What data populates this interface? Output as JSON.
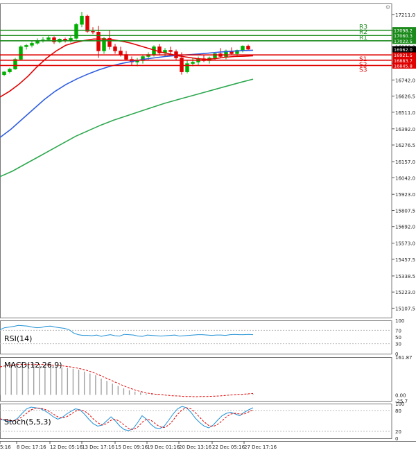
{
  "chart_data": {
    "type": "candlestick",
    "price_panel": {
      "ylim": [
        15040,
        17290
      ],
      "y_ticks": [
        "17211.0",
        "17095.5",
        "16980.0",
        "16862.0",
        "16742.0",
        "16626.5",
        "16511.0",
        "16392.0",
        "16276.5",
        "16157.0",
        "16042.0",
        "15923.0",
        "15807.5",
        "15692.0",
        "15573.0",
        "15457.5",
        "15338.5",
        "15223.0",
        "15107.5"
      ],
      "current_price": {
        "label": "16962.0",
        "value": 16962.0
      },
      "levels": [
        {
          "name": "R3",
          "value": 17098.2,
          "label": "17098.2",
          "color": "#1a8a1a"
        },
        {
          "name": "R2",
          "value": 17060.3,
          "label": "17060.3",
          "color": "#1a8a1a"
        },
        {
          "name": "R1",
          "value": 17022.5,
          "label": "17022.5",
          "color": "#1a8a1a"
        },
        {
          "name": "S1",
          "value": 16921.5,
          "label": "16921.5",
          "color": "#e00000"
        },
        {
          "name": "S2",
          "value": 16883.7,
          "label": "16883.7",
          "color": "#e00000"
        },
        {
          "name": "S3",
          "value": 16845.8,
          "label": "16845.8",
          "color": "#e00000"
        }
      ],
      "candles": [
        [
          16780,
          16805,
          16770,
          16800
        ],
        [
          16800,
          16830,
          16790,
          16820
        ],
        [
          16820,
          16900,
          16815,
          16890
        ],
        [
          16890,
          16990,
          16880,
          16980
        ],
        [
          16980,
          17000,
          16960,
          16990
        ],
        [
          16990,
          17020,
          16975,
          17005
        ],
        [
          17005,
          17040,
          16995,
          17025
        ],
        [
          17025,
          17050,
          17010,
          17030
        ],
        [
          17030,
          17060,
          17020,
          17045
        ],
        [
          17045,
          17055,
          17000,
          17015
        ],
        [
          17015,
          17040,
          17005,
          17035
        ],
        [
          17035,
          17045,
          17010,
          17025
        ],
        [
          17025,
          17060,
          17010,
          17040
        ],
        [
          17040,
          17150,
          17030,
          17140
        ],
        [
          17140,
          17230,
          17120,
          17200
        ],
        [
          17200,
          17210,
          17080,
          17090
        ],
        [
          17090,
          17120,
          17070,
          17085
        ],
        [
          17085,
          17130,
          16900,
          16950
        ],
        [
          16950,
          17050,
          16930,
          17040
        ],
        [
          17040,
          17100,
          16960,
          16980
        ],
        [
          16980,
          17000,
          16930,
          16950
        ],
        [
          16950,
          16980,
          16910,
          16925
        ],
        [
          16925,
          16950,
          16880,
          16890
        ],
        [
          16890,
          16910,
          16850,
          16870
        ],
        [
          16870,
          16900,
          16840,
          16880
        ],
        [
          16880,
          16920,
          16860,
          16910
        ],
        [
          16910,
          16940,
          16880,
          16925
        ],
        [
          16925,
          16990,
          16910,
          16980
        ],
        [
          16980,
          17000,
          16920,
          16935
        ],
        [
          16935,
          16970,
          16910,
          16955
        ],
        [
          16955,
          16980,
          16930,
          16945
        ],
        [
          16945,
          16960,
          16880,
          16900
        ],
        [
          16900,
          16940,
          16780,
          16800
        ],
        [
          16800,
          16880,
          16790,
          16860
        ],
        [
          16860,
          16900,
          16840,
          16870
        ],
        [
          16870,
          16910,
          16850,
          16895
        ],
        [
          16895,
          16920,
          16870,
          16880
        ],
        [
          16880,
          16910,
          16860,
          16900
        ],
        [
          16900,
          16940,
          16880,
          16930
        ],
        [
          16930,
          16970,
          16900,
          16910
        ],
        [
          16910,
          16960,
          16890,
          16950
        ],
        [
          16950,
          16975,
          16920,
          16930
        ],
        [
          16930,
          16960,
          16910,
          16955
        ],
        [
          16955,
          16990,
          16940,
          16985
        ],
        [
          16985,
          16995,
          16955,
          16962
        ]
      ],
      "ma_fast": [
        16620,
        16660,
        16710,
        16770,
        16840,
        16900,
        16950,
        16990,
        17010,
        17025,
        17035,
        17035,
        17030,
        17020,
        17005,
        16985,
        16965,
        16945,
        16930,
        16915,
        16905,
        16895,
        16890,
        16895,
        16905,
        16910,
        16912,
        16915
      ],
      "ma_mid": [
        16330,
        16390,
        16460,
        16530,
        16600,
        16660,
        16710,
        16750,
        16785,
        16815,
        16840,
        16860,
        16875,
        16890,
        16900,
        16910,
        16917,
        16922,
        16928,
        16935,
        16942,
        16948,
        16952,
        16955
      ],
      "ma_slow": [
        16050,
        16090,
        16140,
        16190,
        16240,
        16290,
        16340,
        16380,
        16420,
        16455,
        16485,
        16515,
        16545,
        16575,
        16600,
        16625,
        16650,
        16675,
        16700,
        16725,
        16748
      ]
    },
    "rsi": {
      "label": "RSI(14)",
      "ylim": [
        0,
        100
      ],
      "y_ticks": [
        "100",
        "70",
        "50",
        "30",
        "0"
      ],
      "values": [
        72,
        78,
        80,
        82,
        85,
        84,
        83,
        80,
        78,
        79,
        82,
        83,
        80,
        78,
        76,
        72,
        62,
        57,
        55,
        55,
        54,
        56,
        52,
        55,
        57,
        54,
        53,
        58,
        57,
        56,
        53,
        52,
        56,
        55,
        54,
        53,
        54,
        55,
        56,
        53,
        54,
        55,
        56,
        57,
        57,
        56,
        55,
        56,
        56,
        55,
        57,
        58,
        57,
        57,
        58,
        57
      ]
    },
    "macd": {
      "label": "MACD(12,26,9)",
      "ylim": [
        -25.7,
        161.87
      ],
      "y_ticks": [
        "161.87",
        "0.00",
        "-25.7"
      ],
      "histogram": [
        120,
        128,
        134,
        138,
        136,
        134,
        135,
        132,
        128,
        124,
        122,
        118,
        116,
        112,
        108,
        100,
        92,
        84,
        70,
        60,
        48,
        38,
        28,
        20,
        14,
        10,
        6,
        4,
        3,
        2,
        1,
        1,
        0,
        -1,
        -1,
        0,
        0,
        -1,
        -1,
        0,
        1,
        1,
        2,
        2,
        3,
        3
      ],
      "signal": [
        120,
        125,
        128,
        130,
        131,
        130,
        130,
        131,
        129,
        128,
        126,
        124,
        121,
        117,
        112,
        106,
        98,
        88,
        77,
        66,
        55,
        44,
        34,
        25,
        17,
        11,
        6,
        3,
        1,
        -2,
        -4,
        -5,
        -7,
        -7,
        -8,
        -7,
        -7,
        -6,
        -5,
        -3,
        -1,
        1,
        2,
        4,
        6
      ]
    },
    "stochastic": {
      "label": "Stoch(5,5,3)",
      "ylim": [
        0,
        100
      ],
      "y_ticks": [
        "100",
        "80",
        "20",
        "0"
      ],
      "k": [
        55,
        52,
        48,
        50,
        58,
        72,
        85,
        90,
        88,
        86,
        80,
        72,
        62,
        55,
        60,
        70,
        78,
        85,
        82,
        70,
        55,
        42,
        35,
        38,
        50,
        62,
        50,
        35,
        25,
        22,
        28,
        45,
        65,
        55,
        40,
        30,
        28,
        35,
        52,
        70,
        85,
        92,
        88,
        75,
        58,
        45,
        35,
        30,
        38,
        52,
        65,
        72,
        75,
        70,
        65,
        75,
        82,
        88
      ],
      "d": [
        56,
        54,
        51,
        50,
        54,
        62,
        72,
        82,
        87,
        87,
        84,
        78,
        70,
        62,
        58,
        62,
        70,
        78,
        82,
        79,
        69,
        56,
        45,
        38,
        42,
        52,
        55,
        48,
        38,
        28,
        25,
        32,
        46,
        55,
        52,
        42,
        33,
        31,
        38,
        52,
        69,
        82,
        88,
        85,
        74,
        60,
        47,
        37,
        34,
        40,
        50,
        62,
        70,
        72,
        70,
        70,
        76,
        82
      ]
    },
    "x_tick_labels": [
      "5:16",
      "8 Dec 17:16",
      "12 Dec 05:16",
      "13 Dec 17:16",
      "15 Dec 09:16",
      "19 Dec 01:16",
      "20 Dec 13:16",
      "22 Dec 05:16",
      "27 Dec 17:16"
    ],
    "colors": {
      "bull": "#00b000",
      "bear": "#e00000",
      "ma_fast": "#e00000",
      "ma_mid": "#2f5ee0",
      "ma_slow": "#2ea84f",
      "rsi": "#1e8fd5",
      "stoch_k": "#1e8fd5",
      "stoch_d": "#e00000",
      "macd_hist": "#a0a0a0",
      "macd_signal": "#e00000",
      "current_price_bg": "#000000"
    }
  }
}
